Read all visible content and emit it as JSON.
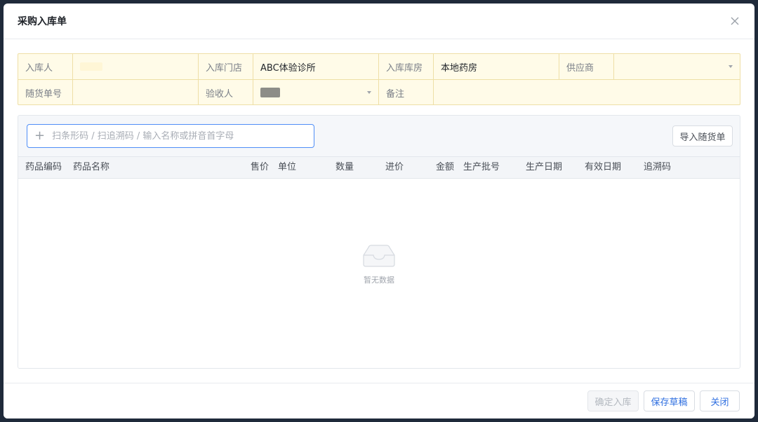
{
  "dialog": {
    "title": "采购入库单"
  },
  "form": {
    "row1": [
      {
        "label": "入库人",
        "value": ""
      },
      {
        "label": "入库门店",
        "value": "ABC体验诊所"
      },
      {
        "label": "入库库房",
        "value": "本地药房"
      },
      {
        "label": "供应商",
        "value": ""
      }
    ],
    "row2": [
      {
        "label": "随货单号",
        "value": ""
      },
      {
        "label": "验收人",
        "value": ""
      },
      {
        "label": "备注",
        "value": ""
      }
    ]
  },
  "search": {
    "placeholder": "扫条形码 / 扫追溯码 / 输入名称或拼音首字母"
  },
  "import_button": "导入随货单",
  "table": {
    "columns": [
      "药品编码",
      "药品名称",
      "售价",
      "单位",
      "数量",
      "进价",
      "金额",
      "生产批号",
      "生产日期",
      "有效日期",
      "追溯码"
    ],
    "empty_text": "暂无数据"
  },
  "footer": {
    "confirm": "确定入库",
    "save_draft": "保存草稿",
    "close": "关闭"
  },
  "colors": {
    "accent": "#2f6fe0",
    "form_bg": "#fffbe8",
    "focus_border": "#4f8ef7"
  }
}
